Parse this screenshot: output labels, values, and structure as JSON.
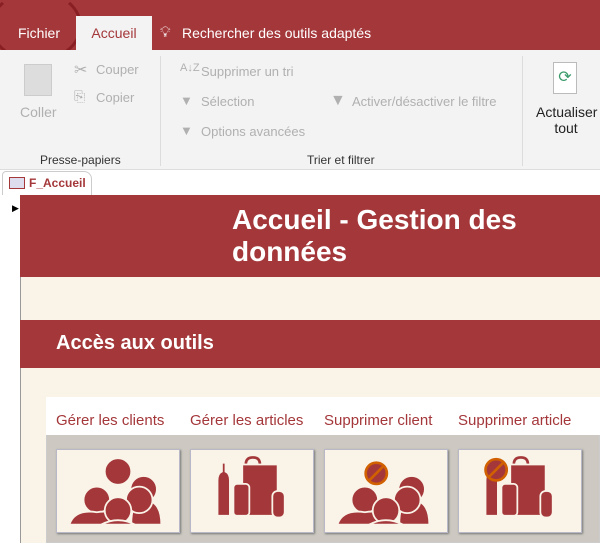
{
  "ribbon": {
    "tabs": [
      "Fichier",
      "Accueil"
    ],
    "search": "Rechercher des outils adaptés",
    "clipboard": {
      "paste": "Coller",
      "cut": "Couper",
      "copy": "Copier",
      "group": "Presse-papiers"
    },
    "sort": {
      "remove_sort": "Supprimer un tri",
      "selection": "Sélection",
      "advanced": "Options avancées",
      "toggle_filter": "Activer/désactiver le filtre",
      "group": "Trier et filtrer"
    },
    "refresh": {
      "line1": "Actualiser",
      "line2": "tout"
    }
  },
  "document_tab": "F_Accueil",
  "form": {
    "title": "Accueil - Gestion des données",
    "section": "Accès aux outils",
    "tools": [
      "Gérer les clients",
      "Gérer les articles",
      "Supprimer client",
      "Supprimer article"
    ]
  },
  "colors": {
    "accent": "#a4373a",
    "cream": "#faf3e8"
  }
}
